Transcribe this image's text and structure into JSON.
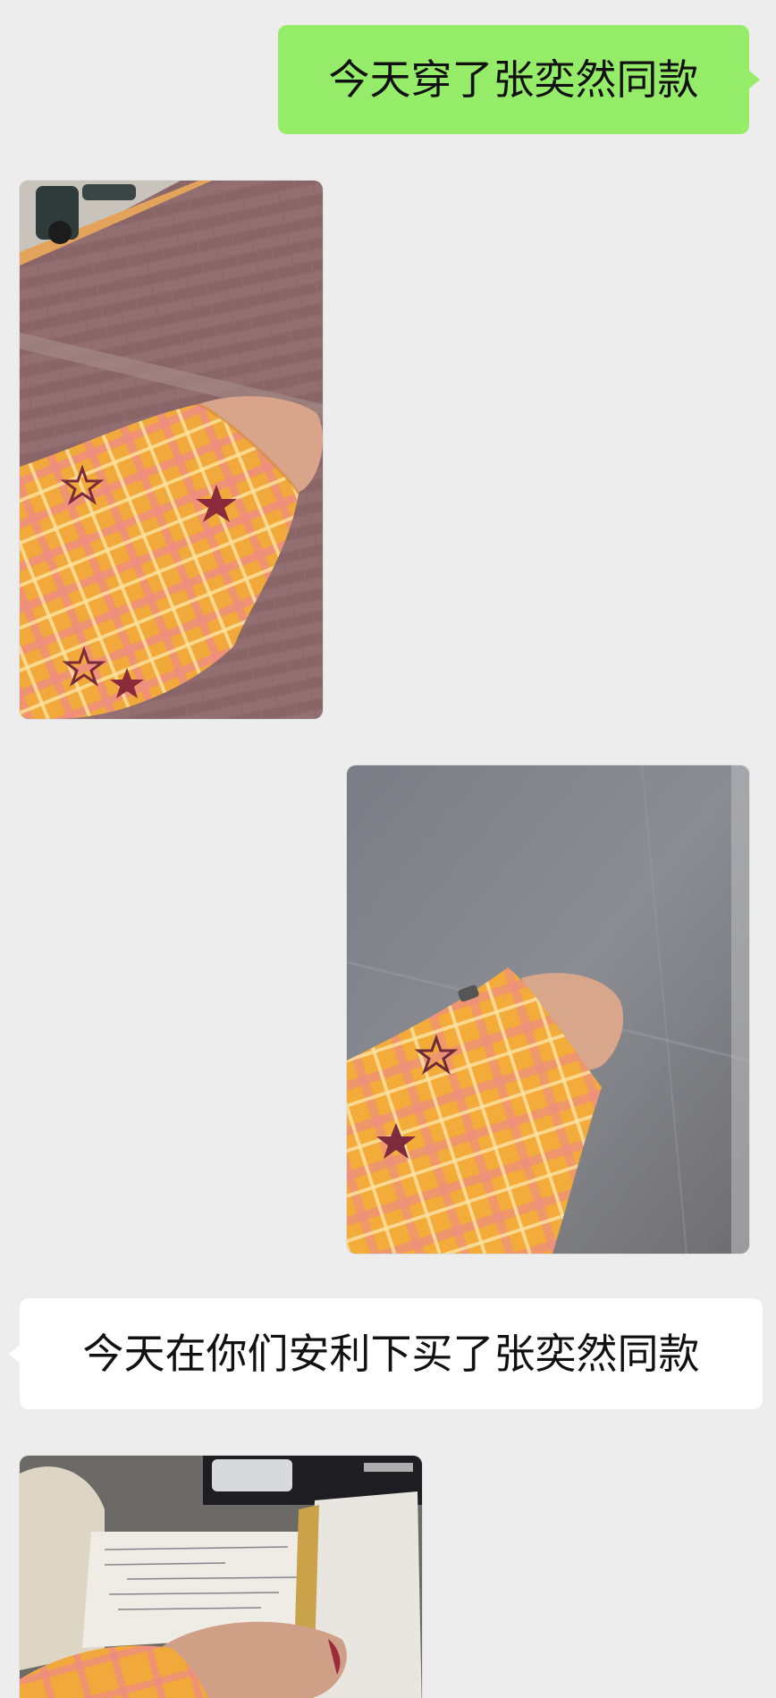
{
  "messages": [
    {
      "type": "text",
      "direction": "outgoing",
      "text": "今天穿了张奕然同款"
    },
    {
      "type": "image",
      "direction": "incoming",
      "icon": "photo-street-sleeve"
    },
    {
      "type": "image",
      "direction": "outgoing",
      "icon": "photo-gray-ground-sleeve"
    },
    {
      "type": "text",
      "direction": "incoming",
      "text": "今天在你们安利下买了张奕然同款"
    },
    {
      "type": "image",
      "direction": "incoming",
      "icon": "photo-desk-notebook"
    }
  ],
  "colors": {
    "background": "#ededed",
    "outgoing_bubble": "#95ec69",
    "incoming_bubble": "#ffffff",
    "plaid_base": "#f2a93b",
    "plaid_pink": "#ef8a86",
    "star": "#7a2a3a"
  }
}
